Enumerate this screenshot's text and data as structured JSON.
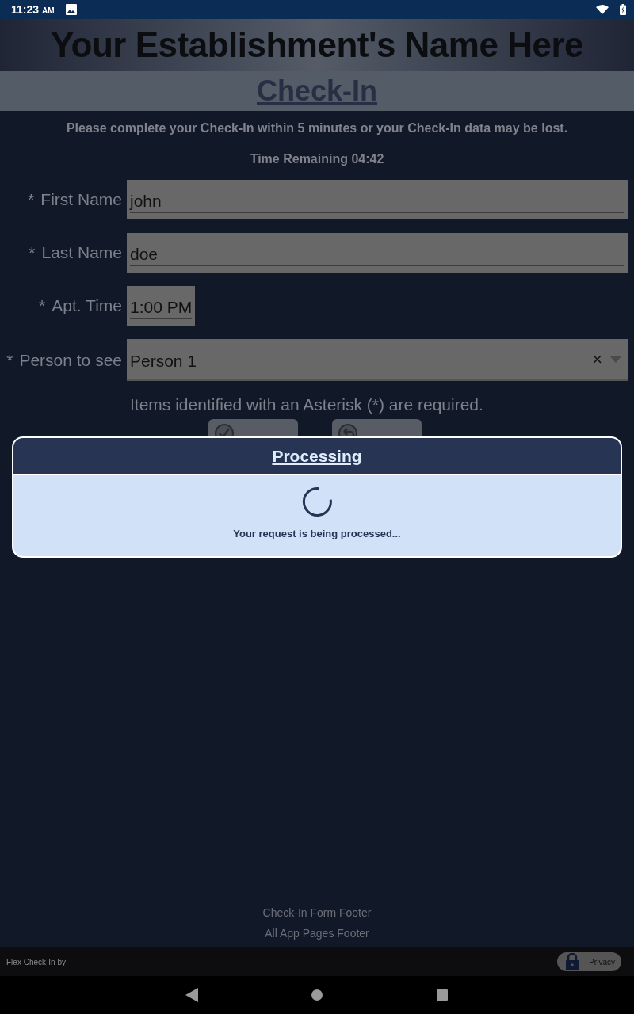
{
  "status_bar": {
    "time": "11:23",
    "time_suffix": "AM"
  },
  "header": {
    "title": "Your Establishment's Name Here",
    "subtitle": "Check-In"
  },
  "notice": "Please complete your Check-In within 5 minutes or your Check-In data may be lost.",
  "timer": "Time Remaining 04:42",
  "fields": [
    {
      "kind": "text",
      "required_mark": "*",
      "label": "First Name",
      "value": "john"
    },
    {
      "kind": "text",
      "required_mark": "*",
      "label": "Last Name",
      "value": "doe"
    },
    {
      "kind": "time",
      "required_mark": "*",
      "label": "Apt. Time",
      "value": "1:00 PM"
    },
    {
      "kind": "select",
      "required_mark": "*",
      "label": "Person to see",
      "value": "Person 1",
      "clear": "×"
    }
  ],
  "required_note": "Items identified with an Asterisk (*) are required.",
  "buttons": [
    {
      "kind": "confirm"
    },
    {
      "kind": "cancel"
    }
  ],
  "dialog": {
    "title": "Processing",
    "message": "Your request is being processed..."
  },
  "footers": [
    "Check-In Form Footer",
    "All App Pages Footer"
  ],
  "bottom_bar": {
    "credit": "Flex Check-In by",
    "privacy": "Privacy"
  }
}
